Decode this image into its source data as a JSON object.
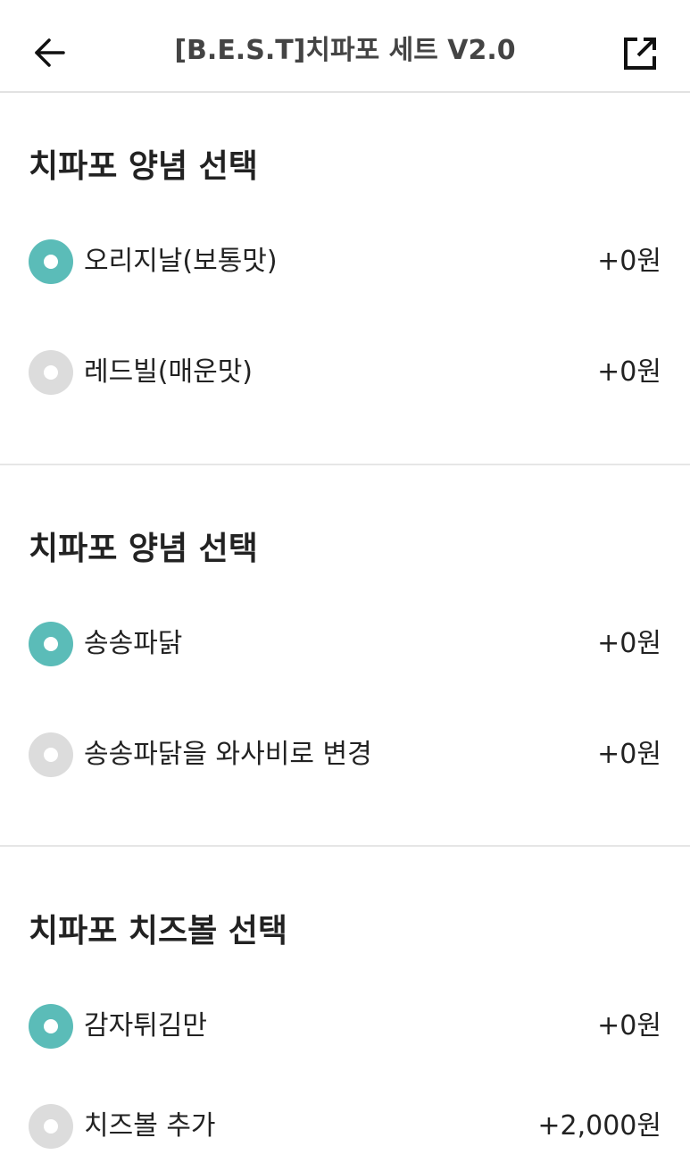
{
  "header": {
    "title": "[B.E.S.T]치파포 세트 V2.0",
    "back_icon": "arrow-left-icon",
    "share_icon": "share-external-icon"
  },
  "colors": {
    "radio_selected": "#5bbcb8",
    "radio_unselected": "#dcdcdc"
  },
  "sections": [
    {
      "title": "치파포 양념 선택",
      "options": [
        {
          "label": "오리지날(보통맛)",
          "price": "+0원",
          "selected": true
        },
        {
          "label": "레드빌(매운맛)",
          "price": "+0원",
          "selected": false
        }
      ]
    },
    {
      "title": "치파포 양념 선택",
      "options": [
        {
          "label": "송송파닭",
          "price": "+0원",
          "selected": true
        },
        {
          "label": "송송파닭을 와사비로 변경",
          "price": "+0원",
          "selected": false
        }
      ]
    },
    {
      "title": "치파포 치즈볼 선택",
      "options": [
        {
          "label": "감자튀김만",
          "price": "+0원",
          "selected": true
        },
        {
          "label": "치즈볼 추가",
          "price": "+2,000원",
          "selected": false
        }
      ]
    }
  ]
}
